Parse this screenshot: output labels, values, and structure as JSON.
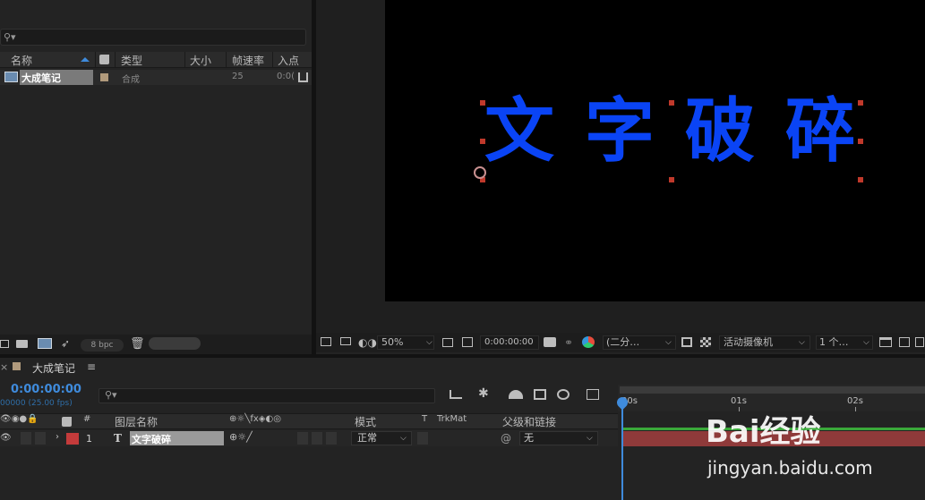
{
  "project": {
    "columns": [
      "名称",
      "类型",
      "大小",
      "帧速率",
      "入点"
    ],
    "item": {
      "name": "大成笔记",
      "type": "合成",
      "fps": "25",
      "in_point": "0:0("
    },
    "bpc": "8 bpc"
  },
  "viewer": {
    "characters": [
      "文",
      "字",
      "破",
      "碎"
    ],
    "text_color": "#0a44f5",
    "zoom": "50%",
    "timecode": "0:00:00:00",
    "resolution": "(二分…",
    "camera": "活动摄像机",
    "views": "1 个…"
  },
  "timeline": {
    "tab_title": "大成笔记",
    "timecode": "0:00:00:00",
    "fps_text": "00000 (25.00 fps)",
    "columns": {
      "num": "#",
      "layer_name": "图层名称",
      "mode": "模式",
      "t": "T",
      "trkmat": "TrkMat",
      "parent": "父级和链接"
    },
    "layer": {
      "index": "1",
      "type": "T",
      "name": "文字破碎",
      "mode": "正常",
      "parent": "无",
      "label_color": "#c43b3b"
    },
    "ruler": [
      "00s",
      "01s",
      "02s"
    ]
  },
  "watermark": {
    "brand": "Bai经验",
    "url": "jingyan.baidu.com"
  }
}
